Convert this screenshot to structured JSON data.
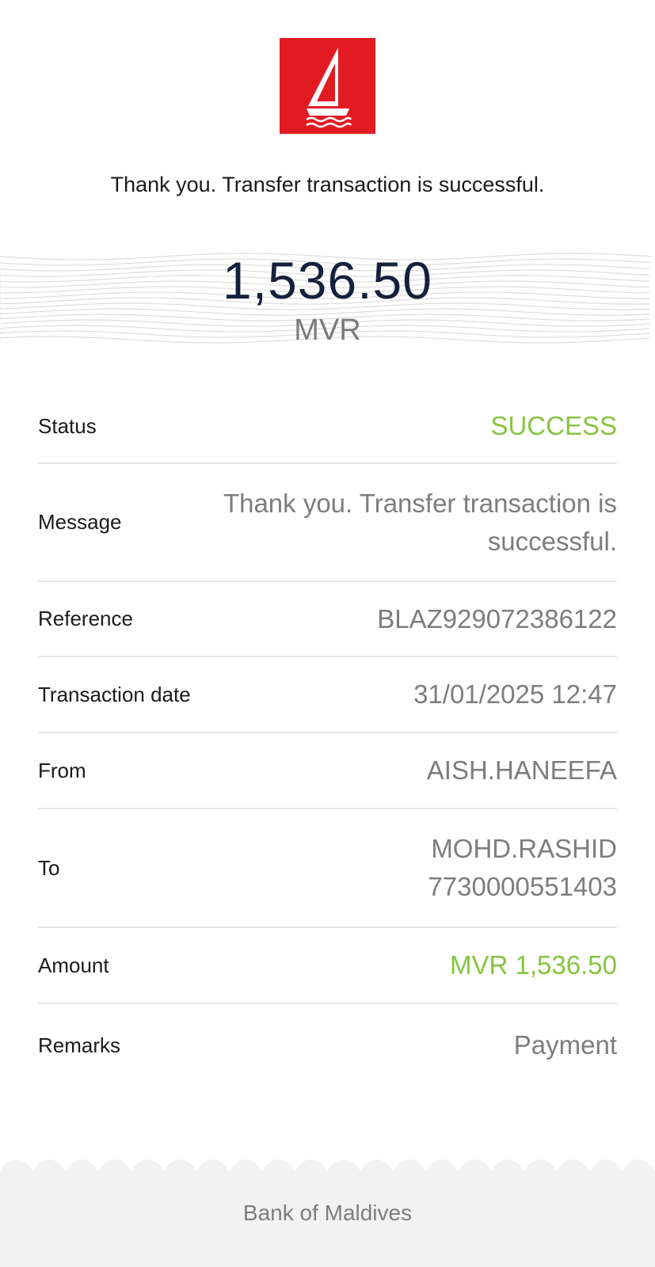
{
  "header": {
    "logo": "bank-logo-boat-icon",
    "message": "Thank you. Transfer transaction is successful."
  },
  "amount": {
    "value": "1,536.50",
    "currency": "MVR"
  },
  "details": {
    "status": {
      "label": "Status",
      "value": "SUCCESS"
    },
    "message": {
      "label": "Message",
      "value": "Thank you. Transfer transaction is successful."
    },
    "reference": {
      "label": "Reference",
      "value": "BLAZ929072386122"
    },
    "transaction_date": {
      "label": "Transaction date",
      "value": "31/01/2025 12:47"
    },
    "from": {
      "label": "From",
      "value": "AISH.HANEEFA"
    },
    "to": {
      "label": "To",
      "name": "MOHD.RASHID",
      "account": "7730000551403"
    },
    "amount": {
      "label": "Amount",
      "value": "MVR 1,536.50"
    },
    "remarks": {
      "label": "Remarks",
      "value": "Payment"
    }
  },
  "footer": {
    "text": "Bank of Maldives"
  },
  "colors": {
    "brand_red": "#e21b23",
    "success_green": "#86c440",
    "amount_navy": "#14213d",
    "muted_gray": "#7d7d7d"
  }
}
